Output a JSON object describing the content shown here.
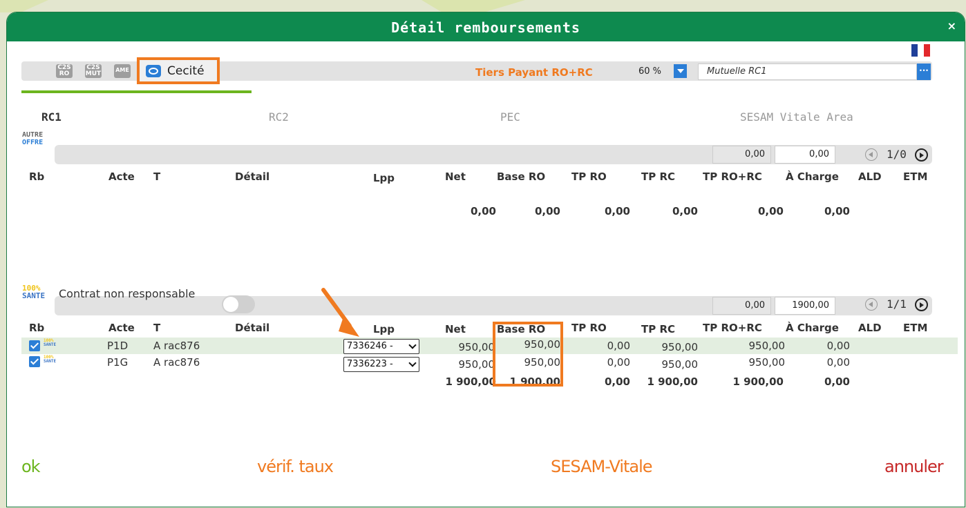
{
  "dialog": {
    "title": "Détail remboursements",
    "close": "×"
  },
  "colors": {
    "accent_green": "#0e8a4f",
    "accent_orange": "#f07a20",
    "accent_blue": "#2b7ed6",
    "ok_green": "#6cb51e",
    "annuler_red": "#c62828"
  },
  "toolbar": {
    "badges": [
      "C2S RO",
      "C2S MUT",
      "AME"
    ],
    "cecite_label": "Cecité",
    "tiers_payant": "Tiers Payant RO+RC",
    "percent": "60 %",
    "mutuelle": "Mutuelle RC1",
    "mutuelle_button": "···"
  },
  "tabs": [
    "RC1",
    "RC2",
    "PEC",
    "SESAM Vitale Area"
  ],
  "columns": [
    "Rb",
    "Acte",
    "T",
    "Détail",
    "Lpp",
    "Net",
    "Base RO",
    "TP RO",
    "TP RC",
    "TP RO+RC",
    "À Charge",
    "ALD",
    "ETM"
  ],
  "section1": {
    "logo_line1": "AUTRE",
    "logo_line2": "OFFRE",
    "box_grey": "0,00",
    "box_white": "0,00",
    "pager": "1/0",
    "totals": {
      "net": "0,00",
      "base_ro": "0,00",
      "tp_ro": "0,00",
      "tp_rc": "0,00",
      "tp_rorc": "0,00",
      "a_charge": "0,00"
    }
  },
  "section2": {
    "logo_line1": "100%",
    "logo_line2": "SANTE",
    "contrat_label": "Contrat non responsable",
    "box_grey": "0,00",
    "box_white": "1900,00",
    "pager": "1/1",
    "rows": [
      {
        "acte": "P1D",
        "detail": "A rac876",
        "lpp": "7336246 -",
        "net": "950,00",
        "base_ro": "950,00",
        "tp_ro": "0,00",
        "tp_rc": "950,00",
        "tp_rorc": "950,00",
        "a_charge": "0,00"
      },
      {
        "acte": "P1G",
        "detail": "A rac876",
        "lpp": "7336223 -",
        "net": "950,00",
        "base_ro": "950,00",
        "tp_ro": "0,00",
        "tp_rc": "950,00",
        "tp_rorc": "950,00",
        "a_charge": "0,00"
      }
    ],
    "totals": {
      "net": "1 900,00",
      "base_ro": "1 900,00",
      "tp_ro": "0,00",
      "tp_rc": "1 900,00",
      "tp_rorc": "1 900,00",
      "a_charge": "0,00"
    }
  },
  "footer": {
    "ok": "ok",
    "verif": "vérif. taux",
    "sesam": "SESAM-Vitale",
    "annuler": "annuler"
  }
}
